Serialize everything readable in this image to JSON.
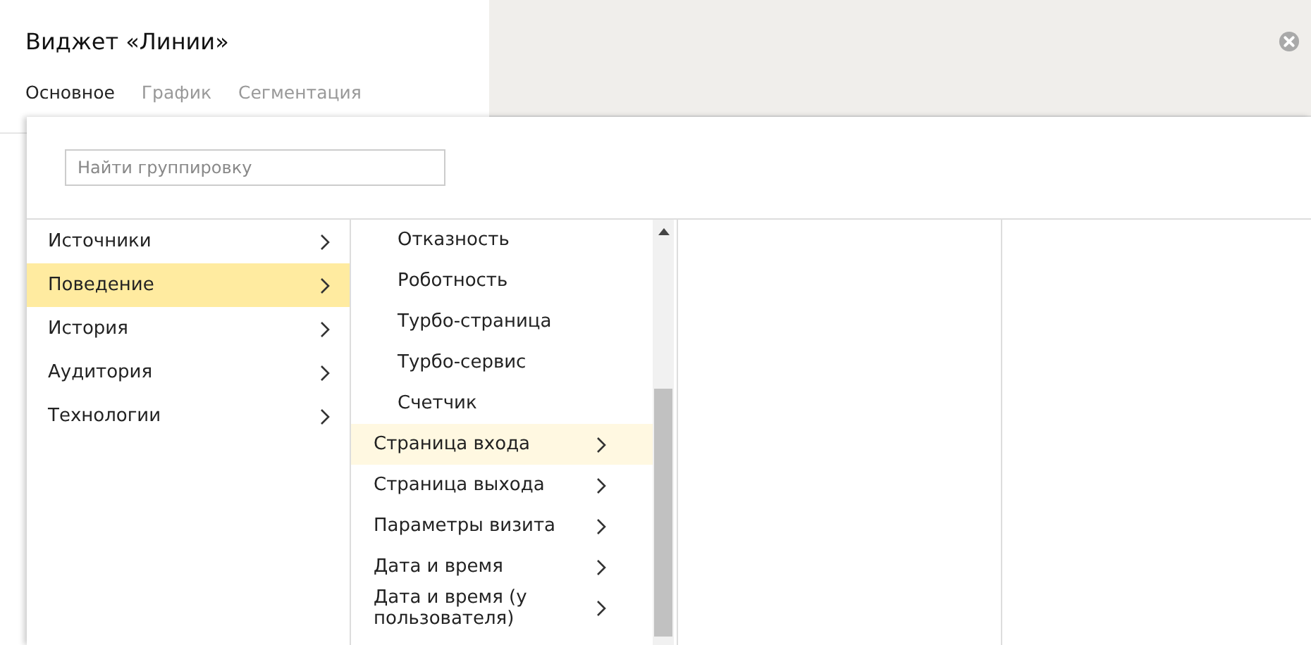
{
  "widget": {
    "title": "Виджет «Линии»",
    "tabs": [
      {
        "label": "Основное",
        "selected": true
      },
      {
        "label": "График",
        "selected": false
      },
      {
        "label": "Сегментация",
        "selected": false
      }
    ]
  },
  "search": {
    "placeholder": "Найти группировку"
  },
  "categories": [
    {
      "label": "Источники",
      "selected": false
    },
    {
      "label": "Поведение",
      "selected": true
    },
    {
      "label": "История",
      "selected": false
    },
    {
      "label": "Аудитория",
      "selected": false
    },
    {
      "label": "Технологии",
      "selected": false
    }
  ],
  "subitems": [
    {
      "label": "Отказность",
      "kind": "leaf",
      "hovered": false
    },
    {
      "label": "Роботность",
      "kind": "leaf",
      "hovered": false
    },
    {
      "label": "Турбо-страница",
      "kind": "leaf",
      "hovered": false
    },
    {
      "label": "Турбо-сервис",
      "kind": "leaf",
      "hovered": false
    },
    {
      "label": "Счетчик",
      "kind": "leaf",
      "hovered": false
    },
    {
      "label": "Страница входа",
      "kind": "group",
      "hovered": true
    },
    {
      "label": "Страница выхода",
      "kind": "group",
      "hovered": false
    },
    {
      "label": "Параметры визита",
      "kind": "group",
      "hovered": false
    },
    {
      "label": "Дата и время",
      "kind": "group",
      "hovered": false
    },
    {
      "label": "Дата и время (у пользователя)",
      "kind": "group",
      "hovered": false
    }
  ]
}
